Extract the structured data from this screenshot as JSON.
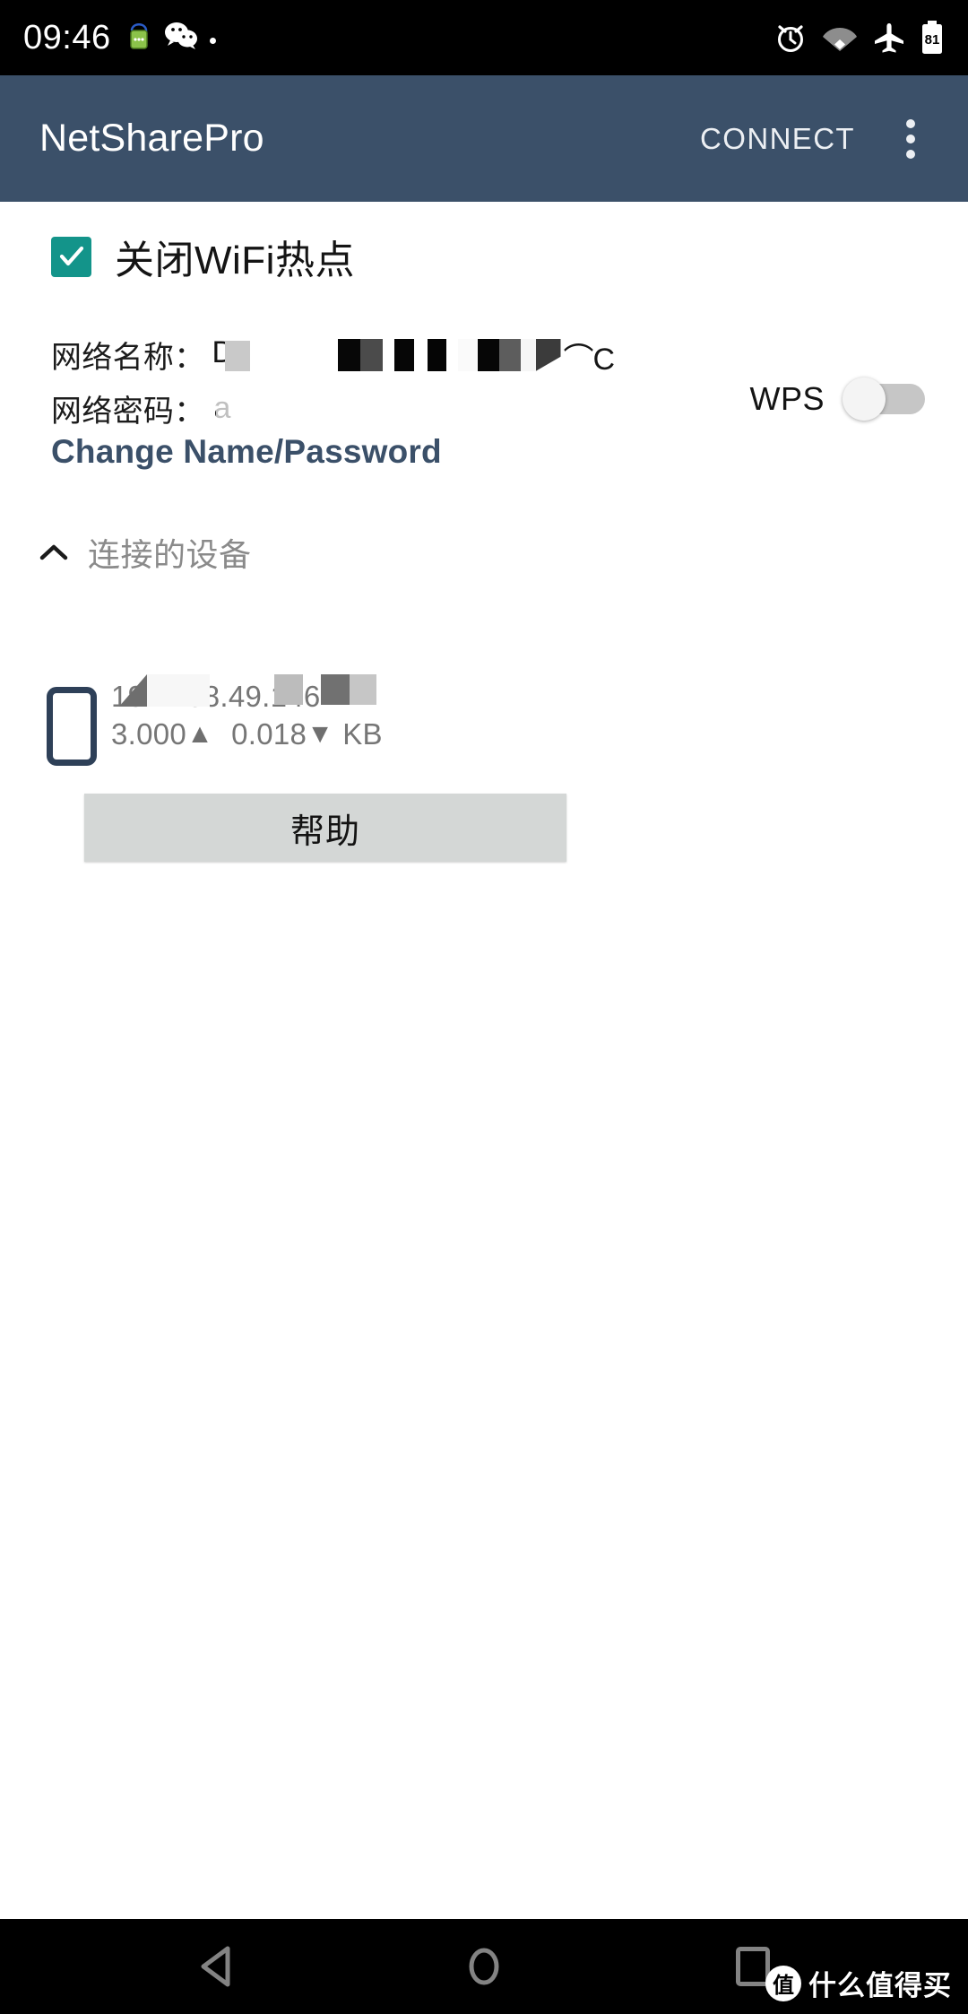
{
  "status_bar": {
    "clock": "09:46",
    "left_icons": [
      "sms-notification-icon",
      "wechat-icon",
      "dot-indicator"
    ],
    "right_icons": [
      "alarm-icon",
      "wifi-icon",
      "airplane-mode-icon",
      "battery-icon"
    ],
    "battery_level": "81"
  },
  "app_bar": {
    "title": "NetSharePro",
    "action_label": "CONNECT",
    "overflow_icon": "more-vertical-icon",
    "background_color": "#3b5069"
  },
  "hotspot": {
    "checkbox_label": "关闭WiFi热点",
    "checkbox_checked": true,
    "checkbox_color": "#13948a",
    "network_name_label": "网络名称：",
    "network_name_value": "D          C",
    "network_name_redacted": true,
    "network_password_label": "网络密码：",
    "network_password_value": "a",
    "network_password_redacted": true,
    "wps_label": "WPS",
    "wps_enabled": false,
    "change_link": "Change Name/Password",
    "change_link_color": "#3b5069"
  },
  "devices_section": {
    "chevron_icon": "chevron-up-icon",
    "title": "连接的设备",
    "expanded": true,
    "devices": [
      {
        "icon": "phone-icon",
        "name": "",
        "name_redacted": true,
        "ip": "192.168.49.146",
        "upload": "3.000",
        "upload_icon": "▲",
        "download": "0.018",
        "download_icon": "▼",
        "unit": "KB"
      }
    ]
  },
  "help_button": {
    "label": "帮助"
  },
  "nav_bar": {
    "back_label": "back-icon",
    "home_label": "home-icon",
    "recents_label": "recents-icon"
  },
  "watermark": {
    "badge": "值",
    "text": "什么值得买"
  }
}
